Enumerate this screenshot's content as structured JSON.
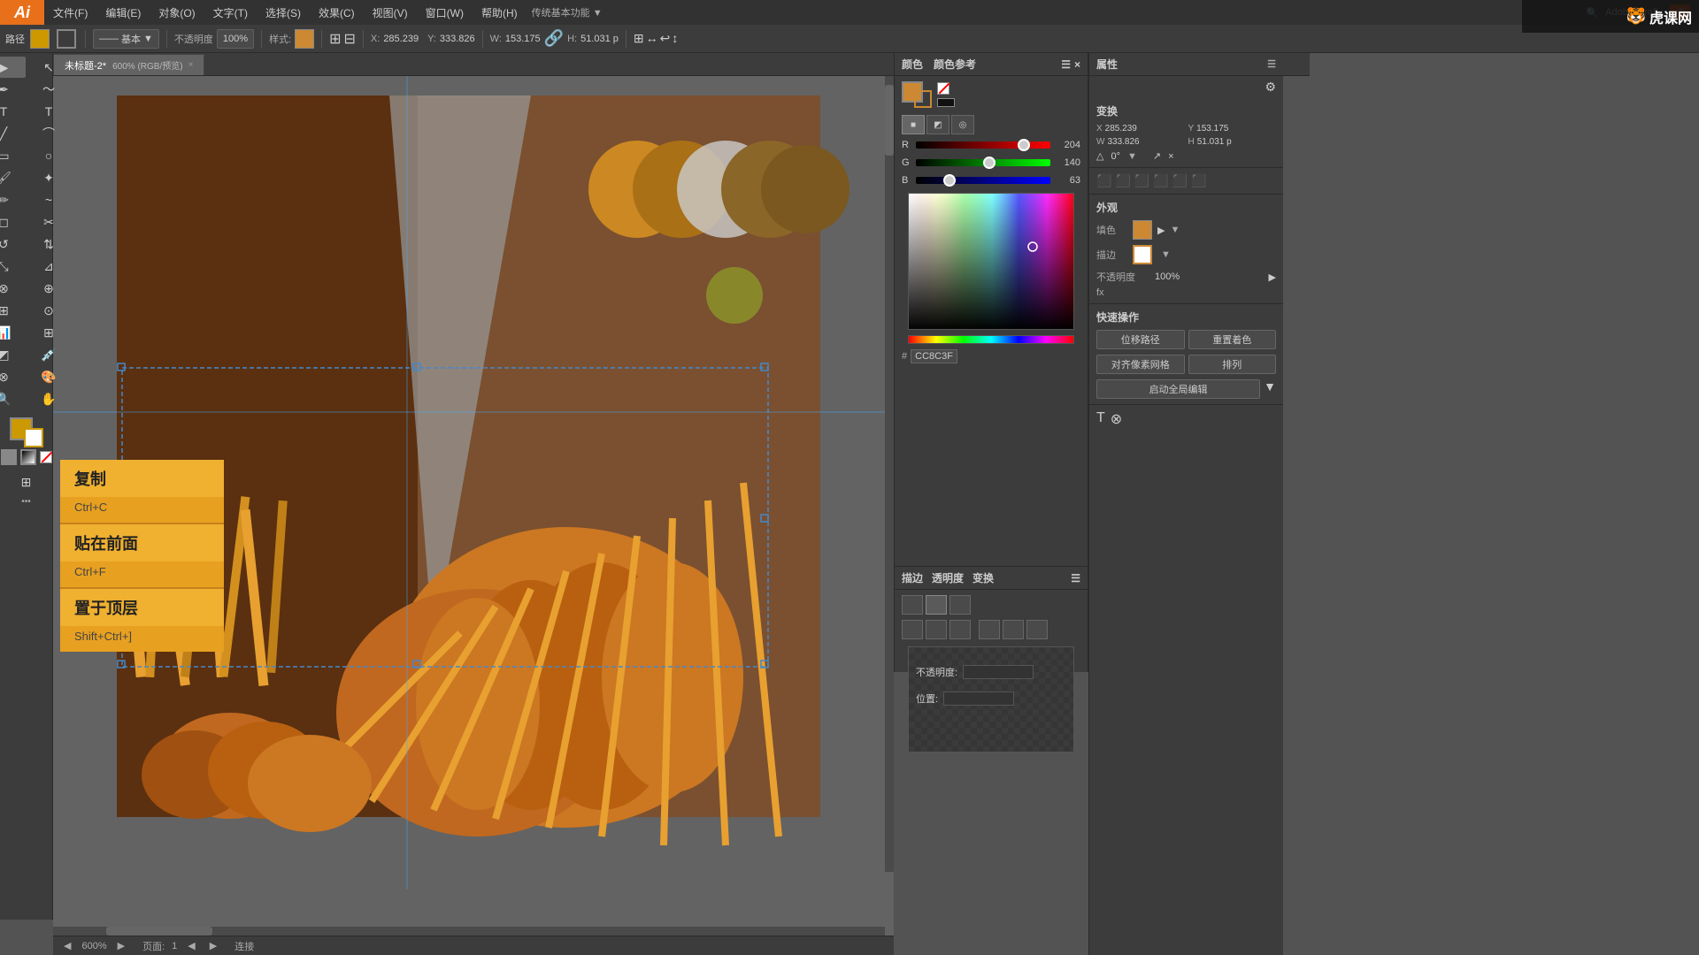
{
  "app": {
    "title": "Ai",
    "logo": "Ai"
  },
  "menu": {
    "items": [
      "文件(F)",
      "编辑(E)",
      "对象(O)",
      "文字(T)",
      "选择(S)",
      "效果(C)",
      "视图(V)",
      "窗口(W)",
      "帮助(H)"
    ]
  },
  "toolbar": {
    "tool_label": "路径",
    "stroke_label": "基本",
    "opacity_label": "不透明度",
    "opacity_value": "100%",
    "style_label": "样式:",
    "x_label": "X:",
    "x_value": "285.239",
    "y_label": "Y:",
    "y_value": "333.826",
    "w_label": "W:",
    "w_value": "153.175",
    "h_label": "H:",
    "h_value": "51.031 p"
  },
  "tab": {
    "label": "未标题-2*",
    "mode": "600% (RGB/预览)",
    "close": "×"
  },
  "status": {
    "zoom": "600%",
    "page": "1",
    "mode": "连接"
  },
  "color_panel": {
    "title": "颜色",
    "tab2": "颜色参考",
    "r_value": "204",
    "g_value": "140",
    "b_value": "63",
    "hex_value": "CC8C3F"
  },
  "context_menu": {
    "item1_main": "复制",
    "item1_shortcut": "Ctrl+C",
    "item2_main": "贴在前面",
    "item2_shortcut": "Ctrl+F",
    "item3_main": "置于顶层",
    "item3_shortcut": "Shift+Ctrl+]"
  },
  "properties_panel": {
    "title": "属性",
    "section_transform": "变换",
    "x_coord": "285.239",
    "y_coord": "153.175",
    "w_coord": "333.826",
    "h_coord": "51.031 p",
    "angle": "0°",
    "appearance_title": "外观",
    "fill_label": "填色",
    "stroke_label": "描边",
    "opacity_label": "不透明度",
    "opacity_value": "100%",
    "fx_label": "fx",
    "btn_offset_path": "位移路径",
    "btn_reset_color": "重置着色",
    "btn_align_pixel": "对齐像素网格",
    "btn_arrange": "排列",
    "btn_full_edit": "启动全局编辑"
  },
  "transparency_panel": {
    "opacity_label": "不透明度:",
    "position_label": "位置:"
  },
  "watermark": {
    "text": "虎课网"
  }
}
